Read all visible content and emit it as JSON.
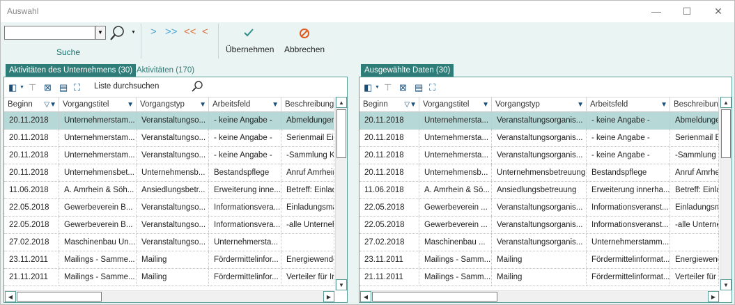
{
  "window": {
    "title": "Auswahl",
    "min": "—",
    "max": "☐",
    "close": "✕"
  },
  "toolbar": {
    "search_value": "",
    "search_label": "Suche",
    "nav": [
      ">",
      ">>",
      "<<",
      "<"
    ],
    "ok_label": "Übernehmen",
    "cancel_label": "Abbrechen"
  },
  "left": {
    "tabs": [
      "Aktivitäten des Unternehmens (30)",
      "Aktivitäten (170)"
    ],
    "search_placeholder": "Liste durchsuchen",
    "columns": [
      "Beginn",
      "Vorgangstitel",
      "Vorgangstyp",
      "Arbeitsfeld",
      "Beschreibung"
    ],
    "rows": [
      [
        "20.11.2018",
        "Unternehmerstam...",
        "Veranstaltungso...",
        "- keine Angabe -",
        "Abmeldungen Einl"
      ],
      [
        "20.11.2018",
        "Unternehmerstam...",
        "Veranstaltungso...",
        "- keine Angabe -",
        "Serienmail Ein"
      ],
      [
        "20.11.2018",
        "Unternehmerstam...",
        "Veranstaltungso...",
        "- keine Angabe -",
        "-Sammlung K"
      ],
      [
        "20.11.2018",
        "Unternehmensbet...",
        "Unternehmensb...",
        "Bestandspflege",
        "Anruf Amrhein"
      ],
      [
        "11.06.2018",
        "A. Amrhein & Söh...",
        "Ansiedlungsbetr...",
        "Erweiterung inne...",
        "Betreff:  Einlad"
      ],
      [
        "22.05.2018",
        "Gewerbeverein B...",
        "Veranstaltungso...",
        "Informationsvera...",
        "Einladungsma"
      ],
      [
        "22.05.2018",
        "Gewerbeverein B...",
        "Veranstaltungso...",
        "Informationsvera...",
        "-alle Unterneh"
      ],
      [
        "27.02.2018",
        "Maschinenbau Un...",
        "Veranstaltungso...",
        "Unternehmersta...",
        ""
      ],
      [
        "23.11.2011",
        "Mailings - Samme...",
        "Mailing",
        "Fördermittelinfor...",
        "Energiewende"
      ],
      [
        "21.11.2011",
        "Mailings - Samme...",
        "Mailing",
        "Fördermittelinfor...",
        "Verteiler für Ir"
      ]
    ]
  },
  "right": {
    "tabs": [
      "Ausgewählte Daten (30)"
    ],
    "columns": [
      "Beginn",
      "Vorgangstitel",
      "Vorgangstyp",
      "Arbeitsfeld",
      "Beschreibung"
    ],
    "rows": [
      [
        "20.11.2018",
        "Unternehmersta...",
        "Veranstaltungsorganis...",
        "- keine Angabe -",
        "Abmeldungen E"
      ],
      [
        "20.11.2018",
        "Unternehmersta...",
        "Veranstaltungsorganis...",
        "- keine Angabe -",
        "Serienmail  E"
      ],
      [
        "20.11.2018",
        "Unternehmersta...",
        "Veranstaltungsorganis...",
        "- keine Angabe -",
        "-Sammlung K"
      ],
      [
        "20.11.2018",
        "Unternehmensb...",
        "Unternehmensbetreuung",
        "Bestandspflege",
        "Anruf Amrhei"
      ],
      [
        "11.06.2018",
        "A. Amrhein & Sö...",
        "Ansiedlungsbetreuung",
        "Erweiterung innerha...",
        "Betreff:  Einla"
      ],
      [
        "22.05.2018",
        "Gewerbeverein ...",
        "Veranstaltungsorganis...",
        "Informationsveranst...",
        "Einladungsm"
      ],
      [
        "22.05.2018",
        "Gewerbeverein ...",
        "Veranstaltungsorganis...",
        "Informationsveranst...",
        "-alle Unterne"
      ],
      [
        "27.02.2018",
        "Maschinenbau ...",
        "Veranstaltungsorganis...",
        "Unternehmerstamm...",
        ""
      ],
      [
        "23.11.2011",
        "Mailings - Samm...",
        "Mailing",
        "Fördermittelinformat...",
        "Energiewende"
      ],
      [
        "21.11.2011",
        "Mailings - Samm...",
        "Mailing",
        "Fördermittelinformat...",
        "Verteiler für L"
      ]
    ]
  },
  "colors": {
    "accent": "#2e7d78",
    "selected_row": "#b6d9d7",
    "toolbar_bg": "#e9f4f3"
  }
}
